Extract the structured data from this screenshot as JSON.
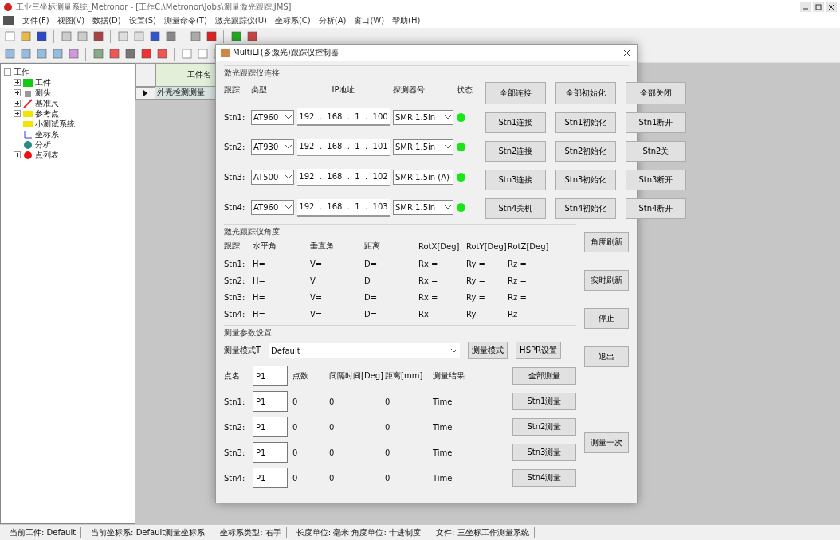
{
  "app_title": "工业三坐标测量系统_Metronor - [工作C:\\Metronor\\Jobs\\测量激光跟踪.JMS]",
  "menu": [
    "文件(F)",
    "视图(V)",
    "数据(D)",
    "设置(S)",
    "测量命令(T)",
    "激光跟踪仪(U)",
    "坐标系(C)",
    "分析(A)",
    "窗口(W)",
    "帮助(H)"
  ],
  "tree": {
    "label": "工作",
    "expanded": true,
    "children": [
      {
        "label": "工件",
        "expanded": false
      },
      {
        "label": "测头",
        "expanded": false
      },
      {
        "label": "基准尺",
        "expanded": false
      },
      {
        "label": "参考点",
        "expanded": false
      },
      {
        "label": "小测试系统"
      },
      {
        "label": "坐标系"
      },
      {
        "label": "分析"
      },
      {
        "label": "点列表",
        "expanded": false
      }
    ]
  },
  "grid": {
    "column": "工件名",
    "rows": [
      {
        "cell": "外壳检测测量",
        "selected": true
      }
    ]
  },
  "dialog": {
    "title": "MultiLT(多激光)跟踪仪控制器",
    "connection": {
      "title": "激光跟踪仪连接",
      "headers": [
        "跟踪",
        "类型",
        "IP地址",
        "探测器号",
        "状态"
      ],
      "all_buttons": [
        "全部连接",
        "全部初始化",
        "全部关闭"
      ],
      "stations": [
        {
          "label": "Stn1:",
          "type": "AT960",
          "ip": "192  .  168  .  1  .  100",
          "reflector": "SMR 1.5in",
          "connected": true,
          "buttons": [
            "Stn1连接",
            "Stn1初始化",
            "Stn1断开"
          ]
        },
        {
          "label": "Stn2:",
          "type": "AT930",
          "ip": "192  .  168  .  1  .  101",
          "reflector": "SMR 1.5in",
          "connected": true,
          "buttons": [
            "Stn2连接",
            "Stn2初始化",
            "Stn2关"
          ]
        },
        {
          "label": "Stn3:",
          "type": "AT500",
          "ip": "192  .  168  .  1  .  102",
          "reflector": "SMR 1.5in (A)",
          "connected": true,
          "buttons": [
            "Stn3连接",
            "Stn3初始化",
            "Stn3断开"
          ]
        },
        {
          "label": "Stn4:",
          "type": "AT960",
          "ip": "192  .  168  .  1  .  103",
          "reflector": "SMR 1.5in",
          "connected": true,
          "buttons": [
            "Stn4关机",
            "Stn4初始化",
            "Stn4断开"
          ]
        }
      ]
    },
    "angles": {
      "title": "激光跟踪仪角度",
      "headers": [
        "跟踪",
        "水平角",
        "垂直角",
        "距离",
        "RotX[Deg]",
        "RotY[Deg]",
        "RotZ[Deg]"
      ],
      "rows": [
        [
          "Stn1:",
          "H=",
          "V=",
          "D=",
          "Rx =",
          "Ry =",
          "Rz ="
        ],
        [
          "Stn2:",
          "H=",
          "V",
          "D",
          "Rx =",
          "Ry =",
          "Rz ="
        ],
        [
          "Stn3:",
          "H=",
          "V=",
          "D=",
          "Rx =",
          "Ry =",
          "Rz ="
        ],
        [
          "Stn4:",
          "H=",
          "V=",
          "D=",
          "Rx",
          "Ry",
          "Rz"
        ]
      ]
    },
    "side_buttons": [
      "角度刷新",
      "实时刷新",
      "停止",
      "退出",
      "测量一次"
    ],
    "measure": {
      "title": "测量参数设置",
      "mode_label": "测量模式T",
      "mode_value": "Default",
      "mode_buttons": [
        "测量模式",
        "HSPR设置"
      ],
      "point_label": "点名",
      "point_value": "P1",
      "headers": [
        "点数",
        "间隔时间[Deg]",
        "距离[mm]",
        "测量结果"
      ],
      "all_button": "全部测量",
      "rows": [
        {
          "label": "Stn1:",
          "point": "P1",
          "values": [
            "0",
            "0",
            "0",
            "Time"
          ],
          "button": "Stn1测量"
        },
        {
          "label": "Stn2:",
          "point": "P1",
          "values": [
            "0",
            "0",
            "0",
            "Time"
          ],
          "button": "Stn2测量"
        },
        {
          "label": "Stn3:",
          "point": "P1",
          "values": [
            "0",
            "0",
            "0",
            "Time"
          ],
          "button": "Stn3测量"
        },
        {
          "label": "Stn4:",
          "point": "P1",
          "values": [
            "0",
            "0",
            "0",
            "Time"
          ],
          "button": "Stn4测量"
        }
      ]
    }
  },
  "status_bar": [
    "当前工件: Default",
    "当前坐标系: Default测量坐标系",
    "坐标系类型: 右手",
    "长度单位: 毫米 角度单位: 十进制度",
    "文件: 三坐标工作测量系统"
  ]
}
